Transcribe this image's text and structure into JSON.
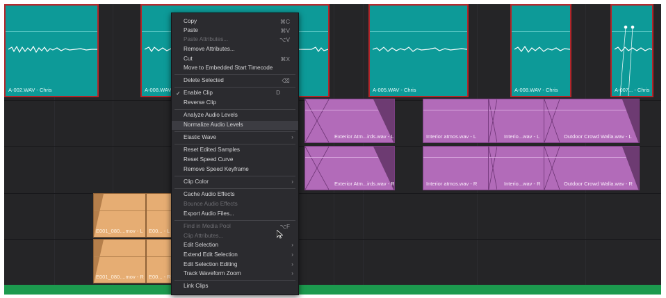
{
  "colors": {
    "teal": "#0d9a98",
    "pink": "#b26bb9",
    "orange": "#e6ad73",
    "green": "#1c9a4e",
    "selected_border": "#b3262a"
  },
  "timeline": {
    "audio_clips_row1": [
      {
        "name": "A-002.WAV - Chris"
      },
      {
        "name": "A-008.WAV - Chris"
      },
      {
        "name": "A-005.WAV - Chris"
      },
      {
        "name": "A-008.WAV - Chris"
      },
      {
        "name": "A-007... - Chris"
      }
    ],
    "pink_clips_L": [
      {
        "name": "Exterior Atm...irds.wav - L"
      },
      {
        "name": "Interior atmos.wav - L"
      },
      {
        "name": "Interio...wav - L"
      },
      {
        "name": "Outdoor Crowd Walla.wav - L"
      }
    ],
    "pink_clips_R": [
      {
        "name": "Exterior Atm...irds.wav - R"
      },
      {
        "name": "Interior atmos.wav - R"
      },
      {
        "name": "Interio...wav - R"
      },
      {
        "name": "Outdoor Crowd Walla.wav - R"
      }
    ],
    "orange_clips_L": [
      {
        "name": "E001_080....mov - L"
      },
      {
        "name": "E00... - L"
      }
    ],
    "orange_clips_R": [
      {
        "name": "E001_080....mov - R"
      },
      {
        "name": "E00... - R"
      }
    ]
  },
  "context_menu": {
    "items": [
      {
        "label": "Copy",
        "shortcut": "⌘C"
      },
      {
        "label": "Paste",
        "shortcut": "⌘V"
      },
      {
        "label": "Paste Attributes...",
        "shortcut": "⌥V"
      },
      {
        "label": "Remove Attributes..."
      },
      {
        "label": "Cut",
        "shortcut": "⌘X"
      },
      {
        "label": "Move to Embedded Start Timecode"
      },
      {
        "label": "Delete Selected",
        "shortcut": "⌫"
      },
      {
        "label": "Enable Clip",
        "shortcut": "D",
        "check": "✓"
      },
      {
        "label": "Reverse Clip"
      },
      {
        "label": "Analyze Audio Levels"
      },
      {
        "label": "Normalize Audio Levels"
      },
      {
        "label": "Elastic Wave",
        "arrow": "›"
      },
      {
        "label": "Reset Edited Samples"
      },
      {
        "label": "Reset Speed Curve"
      },
      {
        "label": "Remove Speed Keyframe"
      },
      {
        "label": "Clip Color",
        "arrow": "›"
      },
      {
        "label": "Cache Audio Effects"
      },
      {
        "label": "Bounce Audio Effects"
      },
      {
        "label": "Export Audio Files..."
      },
      {
        "label": "Find in Media Pool",
        "shortcut": "⌥F"
      },
      {
        "label": "Clip Attributes..."
      },
      {
        "label": "Edit Selection",
        "arrow": "›"
      },
      {
        "label": "Extend Edit Selection",
        "arrow": "›"
      },
      {
        "label": "Edit Selection Editing",
        "arrow": "›"
      },
      {
        "label": "Track Waveform Zoom",
        "arrow": "›"
      },
      {
        "label": "Link Clips"
      }
    ]
  }
}
